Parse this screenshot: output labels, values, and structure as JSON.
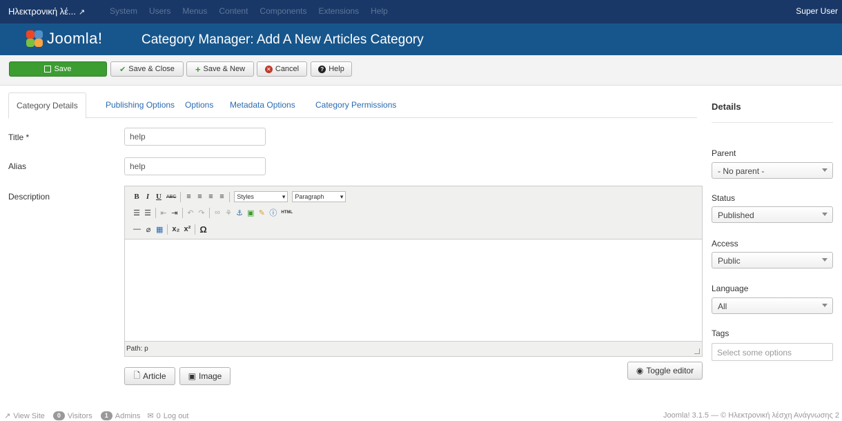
{
  "navbar": {
    "site_name": "Ηλεκτρονική λέ...",
    "menu": [
      "System",
      "Users",
      "Menus",
      "Content",
      "Components",
      "Extensions",
      "Help"
    ],
    "user": "Super User"
  },
  "header": {
    "logo_text": "Joomla!",
    "title": "Category Manager: Add A New Articles Category"
  },
  "toolbar": {
    "save": "Save",
    "save_close": "Save & Close",
    "save_new": "Save & New",
    "cancel": "Cancel",
    "help": "Help"
  },
  "tabs": [
    "Category Details",
    "Publishing Options",
    "Options",
    "Metadata Options",
    "Category Permissions"
  ],
  "form": {
    "title_label": "Title *",
    "title_value": "help",
    "alias_label": "Alias",
    "alias_value": "help",
    "description_label": "Description"
  },
  "editor": {
    "styles": "Styles",
    "format": "Paragraph",
    "path": "Path: p",
    "article_button": "Article",
    "image_button": "Image",
    "toggle_button": "Toggle editor"
  },
  "details": {
    "title": "Details",
    "parent_label": "Parent",
    "parent_value": "- No parent -",
    "status_label": "Status",
    "status_value": "Published",
    "access_label": "Access",
    "access_value": "Public",
    "language_label": "Language",
    "language_value": "All",
    "tags_label": "Tags",
    "tags_placeholder": "Select some options"
  },
  "footer": {
    "view_site": "View Site",
    "visitors_count": "0",
    "visitors_label": "Visitors",
    "admins_count": "1",
    "admins_label": "Admins",
    "messages": "0",
    "logout": "Log out",
    "copyright": "Joomla! 3.1.5 — © Ηλεκτρονική λέσχη Ανάγνωσης 2"
  },
  "colors": {
    "navbar": "#1a3867",
    "header": "#17568c",
    "save_button": "#3c9d31",
    "link": "#2a6bb0"
  }
}
